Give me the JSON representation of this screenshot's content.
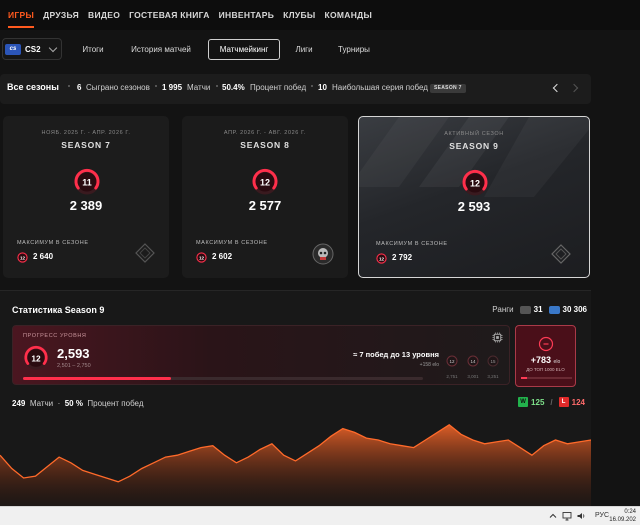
{
  "nav": {
    "items": [
      "ИГРЫ",
      "ДРУЗЬЯ",
      "ВИДЕО",
      "ГОСТЕВАЯ КНИГА",
      "ИНВЕНТАРЬ",
      "КЛУБЫ",
      "КОМАНДЫ"
    ],
    "active_index": 0,
    "accent_color": "#ff5a1f"
  },
  "game": {
    "logo": "cs",
    "name": "CS2"
  },
  "subtabs": [
    "Итоги",
    "История матчей",
    "Матчмейкинг",
    "Лиги",
    "Турниры"
  ],
  "subtab_active": 2,
  "seasons_bar": {
    "title": "Все сезоны",
    "seasons_played_value": "6",
    "seasons_played_label": "Сыграно сезонов",
    "matches_value": "1 995",
    "matches_label": "Матчи",
    "winrate_value": "50.4%",
    "winrate_label": "Процент побед",
    "streak_value": "10",
    "streak_label": "Наибольшая серия побед",
    "streak_season": "SEASON 7"
  },
  "season_cards": [
    {
      "date": "НОЯБ. 2025 Г. - АПР. 2026 Г.",
      "name": "SEASON 7",
      "rank": "11",
      "elo": "2 389",
      "max_label": "Максимум в сезоне",
      "max_rank": "12",
      "max_elo": "2 640"
    },
    {
      "date": "АПР. 2026 Г. - АВГ. 2026 Г.",
      "name": "SEASON 8",
      "rank": "12",
      "elo": "2 577",
      "max_label": "Максимум в сезоне",
      "max_rank": "12",
      "max_elo": "2 602"
    },
    {
      "date": "АКТИВНЫЙ СЕЗОН",
      "name": "SEASON 9",
      "rank": "12",
      "elo": "2 593",
      "max_label": "Максимум в сезоне",
      "max_rank": "12",
      "max_elo": "2 792"
    }
  ],
  "stats": {
    "title": "Статистика Season 9",
    "ranks_label": "Ранги",
    "rank_a": "31",
    "rank_b": "30 306",
    "progress_label": "ПРОГРЕСС УРОВНЯ",
    "level": "12",
    "elo": "2,593",
    "range": "2,501 – 2,750",
    "need": "≈ 7 побед до 13 уровня",
    "bonus": "+158 elo",
    "progress": 0.37,
    "mini_levels": [
      {
        "lvl": "12",
        "elo": "2,751"
      },
      {
        "lvl": "14",
        "elo": "3,001"
      },
      {
        "lvl": "15",
        "elo": "3,251"
      }
    ],
    "next_plus": "+783",
    "next_unit": "elo",
    "next_to": "ДО ТОП 1000 ELO",
    "next_progress": 0.12,
    "matches_value": "249",
    "matches_label": "Матчи",
    "winrate_value": "50 %",
    "winrate_label": "Процент побед",
    "wins_letter": "W",
    "wins": "125",
    "losses_letter": "L",
    "losses": "124"
  },
  "chart_data": {
    "type": "area",
    "x": [
      0,
      1,
      2,
      3,
      4,
      5,
      6,
      7,
      8,
      9,
      10,
      11,
      12,
      13,
      14,
      15,
      16,
      17,
      18,
      19,
      20,
      21,
      22,
      23,
      24,
      25,
      26,
      27,
      28,
      29,
      30,
      31,
      32,
      33,
      34,
      35,
      36,
      37,
      38,
      39,
      40,
      41,
      42,
      43,
      44,
      45,
      46,
      47,
      48,
      49,
      50
    ],
    "values": [
      2560,
      2525,
      2500,
      2505,
      2530,
      2555,
      2540,
      2520,
      2510,
      2500,
      2490,
      2505,
      2525,
      2540,
      2555,
      2560,
      2570,
      2580,
      2585,
      2560,
      2540,
      2555,
      2575,
      2590,
      2560,
      2545,
      2565,
      2585,
      2610,
      2630,
      2620,
      2605,
      2600,
      2590,
      2585,
      2580,
      2600,
      2620,
      2640,
      2615,
      2600,
      2590,
      2595,
      2600,
      2580,
      2560,
      2585,
      2600,
      2590,
      2595,
      2600
    ],
    "color": "#ff6a2a",
    "grid": false
  },
  "taskbar": {
    "lang": "РУС",
    "time": "0:24",
    "date": "16.09.202"
  }
}
